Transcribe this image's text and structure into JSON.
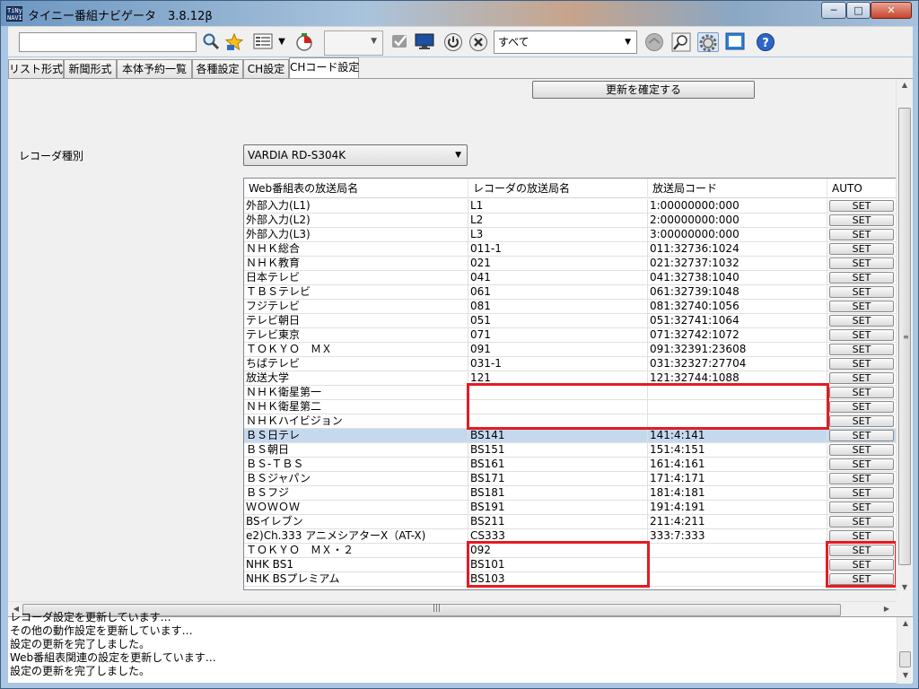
{
  "window": {
    "title": "タイニー番組ナビゲータ　3.8.12β",
    "icon_text": "TiNy\nNAVI",
    "controls": {
      "minimize": "─",
      "maximize": "□",
      "close": "✕"
    }
  },
  "toolbar": {
    "search_value": "",
    "filter_selected": "すべて",
    "icons": [
      "search-icon",
      "favorite-star-icon",
      "listview-icon",
      "dropdown-arrow-icon",
      "timer-icon",
      "checkmark-icon",
      "monitor-icon",
      "power-icon",
      "cancel-icon",
      "globe-icon",
      "magnifier-icon",
      "settings-gear-icon",
      "fullscreen-icon",
      "help-icon"
    ]
  },
  "tabs": [
    "リスト形式",
    "新聞形式",
    "本体予約一覧",
    "各種設定",
    "CH設定",
    "CHコード設定"
  ],
  "active_tab": "CHコード設定",
  "update_button": "更新を確定する",
  "recorder": {
    "label": "レコーダ種別",
    "selected": "VARDIA RD-S304K"
  },
  "grid": {
    "headers": [
      "Web番組表の放送局名",
      "レコーダの放送局名",
      "放送局コード",
      "AUTO"
    ],
    "set_label": "SET",
    "rows": [
      {
        "web": "外部入力(L1)",
        "rec": "L1",
        "code": "1:00000000:000"
      },
      {
        "web": "外部入力(L2)",
        "rec": "L2",
        "code": "2:00000000:000"
      },
      {
        "web": "外部入力(L3)",
        "rec": "L3",
        "code": "3:00000000:000"
      },
      {
        "web": "ＮＨＫ総合",
        "rec": "011-1",
        "code": "011:32736:1024"
      },
      {
        "web": "ＮＨＫ教育",
        "rec": "021",
        "code": "021:32737:1032"
      },
      {
        "web": "日本テレビ",
        "rec": "041",
        "code": "041:32738:1040"
      },
      {
        "web": "ＴＢＳテレビ",
        "rec": "061",
        "code": "061:32739:1048"
      },
      {
        "web": "フジテレビ",
        "rec": "081",
        "code": "081:32740:1056"
      },
      {
        "web": "テレビ朝日",
        "rec": "051",
        "code": "051:32741:1064"
      },
      {
        "web": "テレビ東京",
        "rec": "071",
        "code": "071:32742:1072"
      },
      {
        "web": "ＴＯＫＹＯ　ＭＸ",
        "rec": "091",
        "code": "091:32391:23608"
      },
      {
        "web": "ちばテレビ",
        "rec": "031-1",
        "code": "031:32327:27704"
      },
      {
        "web": "放送大学",
        "rec": "121",
        "code": "121:32744:1088"
      },
      {
        "web": "ＮＨＫ衛星第一",
        "rec": "",
        "code": ""
      },
      {
        "web": "ＮＨＫ衛星第二",
        "rec": "",
        "code": ""
      },
      {
        "web": "ＮＨＫハイビジョン",
        "rec": "",
        "code": ""
      },
      {
        "web": "ＢＳ日テレ",
        "rec": "BS141",
        "code": "141:4:141",
        "selected": true
      },
      {
        "web": "ＢＳ朝日",
        "rec": "BS151",
        "code": "151:4:151"
      },
      {
        "web": "ＢＳ-ＴＢＳ",
        "rec": "BS161",
        "code": "161:4:161"
      },
      {
        "web": "ＢＳジャパン",
        "rec": "BS171",
        "code": "171:4:171"
      },
      {
        "web": "ＢＳフジ",
        "rec": "BS181",
        "code": "181:4:181"
      },
      {
        "web": "ＷＯＷＯＷ",
        "rec": "BS191",
        "code": "191:4:191"
      },
      {
        "web": "BSイレブン",
        "rec": "BS211",
        "code": "211:4:211"
      },
      {
        "web": "e2)Ch.333 アニメシアターX（AT-X)",
        "rec": "CS333",
        "code": "333:7:333"
      },
      {
        "web": "ＴＯＫＹＯ　ＭＸ・２",
        "rec": "092",
        "code": ""
      },
      {
        "web": "NHK BS1",
        "rec": "BS101",
        "code": ""
      },
      {
        "web": "NHK BSプレミアム",
        "rec": "BS103",
        "code": ""
      }
    ]
  },
  "highlight_color": "#e31b23",
  "log": {
    "lines": [
      "レコーダ設定を更新しています…",
      "その他の動作設定を更新しています…",
      "設定の更新を完了しました。",
      "Web番組表関連の設定を更新しています…",
      "設定の更新を完了しました。"
    ]
  },
  "scroll_grip": "≡"
}
